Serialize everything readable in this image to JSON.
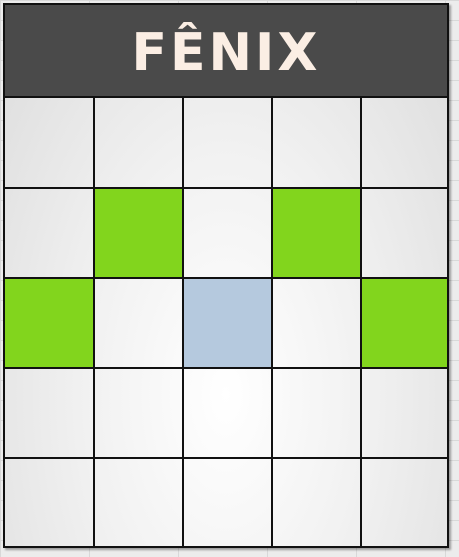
{
  "title": "FÊNIX",
  "grid": {
    "rows": 5,
    "cols": 5,
    "cells": [
      [
        "empty",
        "empty",
        "empty",
        "empty",
        "empty"
      ],
      [
        "empty",
        "green",
        "empty",
        "green",
        "empty"
      ],
      [
        "green",
        "empty",
        "blue",
        "empty",
        "green"
      ],
      [
        "empty",
        "empty",
        "empty",
        "empty",
        "empty"
      ],
      [
        "empty",
        "empty",
        "empty",
        "empty",
        "empty"
      ]
    ]
  },
  "colors": {
    "header": "#4a4a4a",
    "title_text": "#fbeee4",
    "green": "#82d51d",
    "blue": "#b5c9de",
    "grid_line": "#111111"
  }
}
